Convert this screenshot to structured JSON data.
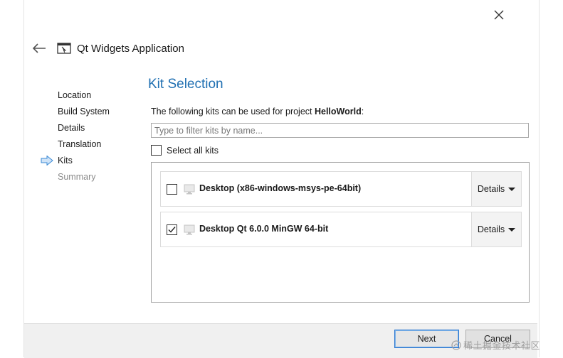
{
  "window": {
    "title": "Qt Widgets Application",
    "close_icon": "close-icon",
    "back_icon": "back-arrow-icon",
    "app_icon": "qt-window-icon"
  },
  "wizard_steps": [
    {
      "label": "Location",
      "state": "done"
    },
    {
      "label": "Build System",
      "state": "done"
    },
    {
      "label": "Details",
      "state": "done"
    },
    {
      "label": "Translation",
      "state": "done"
    },
    {
      "label": "Kits",
      "state": "current"
    },
    {
      "label": "Summary",
      "state": "pending"
    }
  ],
  "page": {
    "title": "Kit Selection",
    "description_prefix": "The following kits can be used for project ",
    "project_name": "HelloWorld",
    "description_suffix": ":",
    "filter_placeholder": "Type to filter kits by name...",
    "filter_value": "",
    "select_all_label": "Select all kits",
    "select_all_checked": false
  },
  "kits": [
    {
      "name": "Desktop (x86-windows-msys-pe-64bit)",
      "checked": false,
      "details_label": "Details",
      "icon": "monitor-icon"
    },
    {
      "name": "Desktop Qt 6.0.0 MinGW 64-bit",
      "checked": true,
      "details_label": "Details",
      "icon": "monitor-icon"
    }
  ],
  "footer": {
    "next_label": "Next",
    "cancel_label": "Cancel"
  },
  "watermark": {
    "text": "稀土掘金技术社区"
  },
  "colors": {
    "accent": "#1f6fb2",
    "step_arrow": "#3a8ad6",
    "footer_bg": "#f0f0f0"
  }
}
